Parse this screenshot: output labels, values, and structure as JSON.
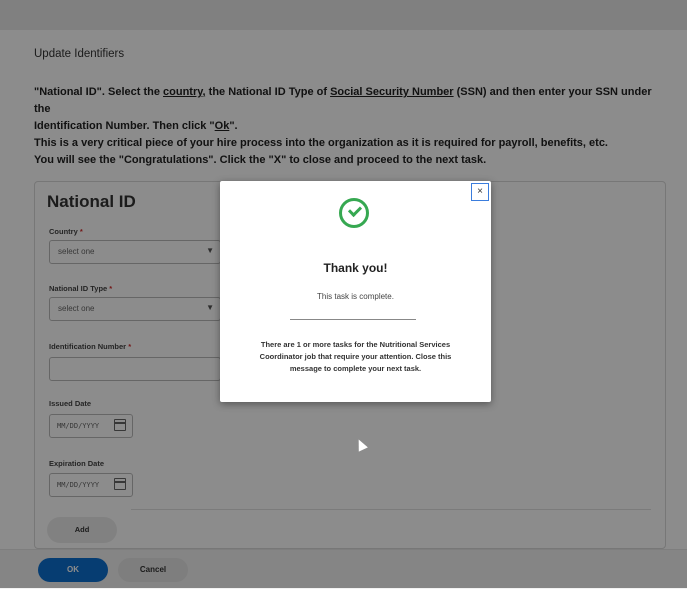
{
  "page": {
    "heading": "Update Identifiers",
    "instructions": {
      "line1_pre": "\"National ID\". Select the ",
      "line1_country": "country,",
      "line1_mid": " the National ID Type of ",
      "line1_ssn": "Social Security Number",
      "line1_post": " (SSN) and then enter your SSN under the",
      "line2_pre": "Identification Number. Then click \"",
      "line2_ok": "Ok",
      "line2_post": "\".",
      "line3": "This is a very critical piece of your hire process into the organization as it is required for payroll, benefits, etc.",
      "line4": "You will see the \"Congratulations\". Click the \"X\" to close and proceed to the next task."
    }
  },
  "form": {
    "title": "National ID",
    "required_mark": "*",
    "country_label": "Country",
    "country_value": "select one",
    "id_type_label": "National ID Type",
    "id_type_value": "select one",
    "id_number_label": "Identification Number",
    "issued_label": "Issued Date",
    "issued_placeholder": "MM/DD/YYYY",
    "expiration_label": "Expiration Date",
    "expiration_placeholder": "MM/DD/YYYY",
    "add_label": "Add",
    "caret": "▼"
  },
  "footer": {
    "ok_label": "OK",
    "cancel_label": "Cancel"
  },
  "modal": {
    "close_symbol": "×",
    "title": "Thank you!",
    "subtitle": "This task is complete.",
    "message": "There are 1 or more tasks for the Nutritional Services Coordinator job that require your attention. Close this message to complete your next task.",
    "success_color": "#36a851"
  },
  "colors": {
    "primary": "#0b6fd0",
    "required": "#d32f2f"
  }
}
